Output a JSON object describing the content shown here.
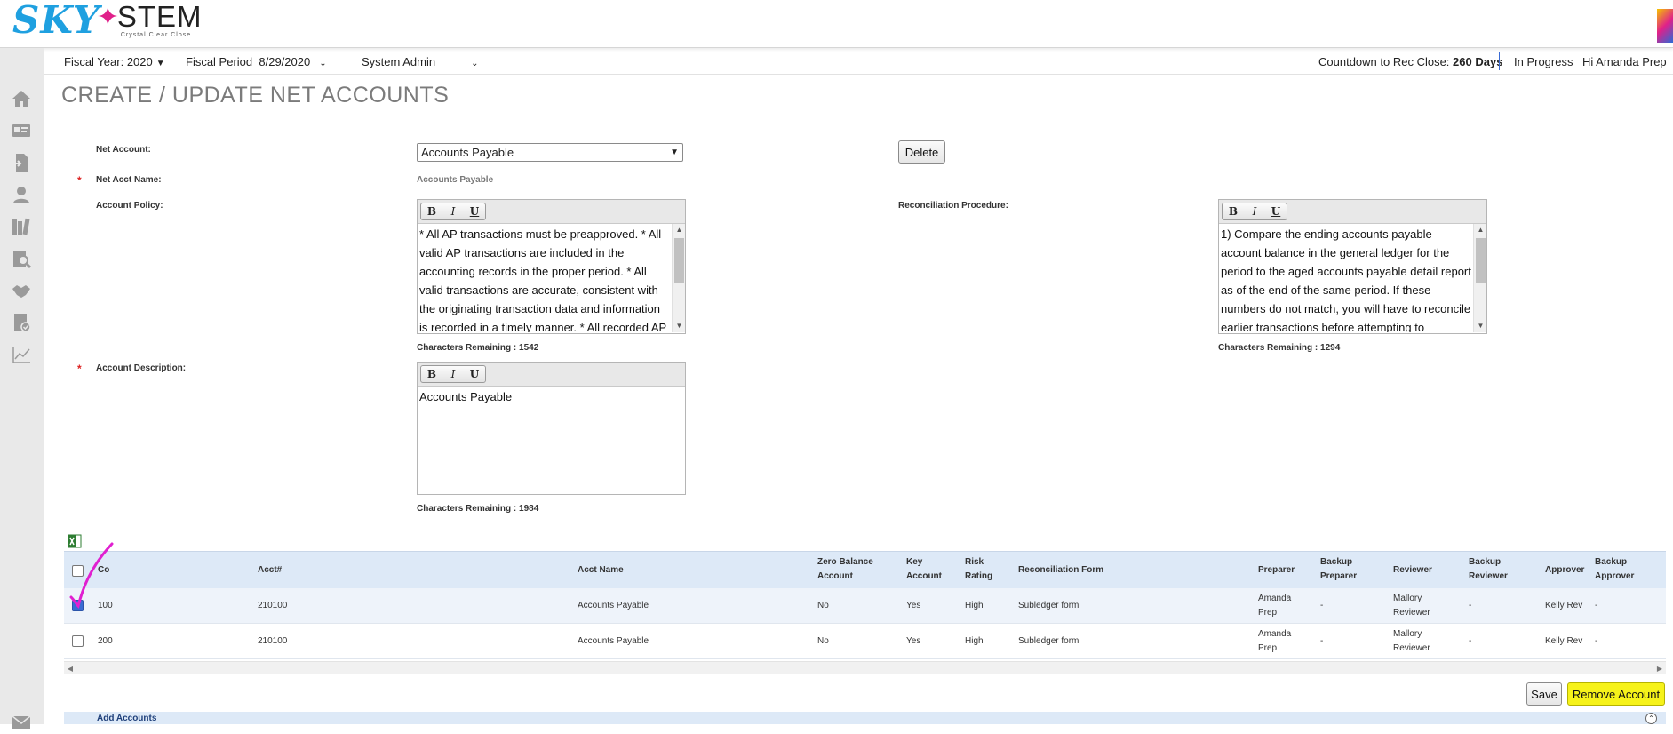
{
  "brand": {
    "logo_sky": "SKY",
    "logo_stem": "STEM",
    "tagline": "Crystal Clear Close"
  },
  "subheader": {
    "fiscal_year": "Fiscal Year: 2020",
    "fiscal_period_label": "Fiscal Period",
    "fiscal_period_value": "8/29/2020",
    "role": "System Admin",
    "countdown_label": "Countdown to Rec Close:",
    "countdown_value": "260 Days",
    "status": "In Progress",
    "greeting": "Hi Amanda Prep"
  },
  "sidebar": {
    "icons": [
      "home-icon",
      "id-card-icon",
      "document-import-icon",
      "user-icon",
      "books-icon",
      "search-report-icon",
      "handshake-icon",
      "checklist-icon",
      "chart-icon"
    ]
  },
  "page": {
    "title": "CREATE / UPDATE NET ACCOUNTS"
  },
  "form": {
    "net_account_label": "Net Account:",
    "net_account_value": "Accounts Payable",
    "delete_label": "Delete",
    "net_acct_name_label": "Net Acct Name:",
    "net_acct_name_value": "Accounts Payable",
    "account_policy_label": "Account Policy:",
    "account_policy_text": "* All AP transactions must be preapproved. * All valid AP transactions are included in the accounting records in the proper period. * All valid transactions are accurate, consistent with the originating transaction data and information is recorded in a timely manner. * All recorded AP",
    "account_policy_chars": "Characters Remaining : 1542",
    "reconciliation_procedure_label": "Reconciliation Procedure:",
    "reconciliation_procedure_text": "1) Compare the ending accounts payable account balance in the general ledger for the period to the aged accounts payable detail report as of the end of the same period.  If these numbers do not match, you will have to reconcile earlier transactions before attempting to reconcile this",
    "reconciliation_procedure_chars": "Characters Remaining : 1294",
    "account_description_label": "Account Description:",
    "account_description_text": "Accounts Payable",
    "account_description_chars": "Characters Remaining : 1984",
    "required_mark": "*"
  },
  "editor_buttons": {
    "bold": "B",
    "italic": "I",
    "underline": "U"
  },
  "table": {
    "headers": {
      "co": "Co",
      "acct_no": "Acct#",
      "acct_name": "Acct Name",
      "zero_balance_1": "Zero Balance",
      "zero_balance_2": "Account",
      "key_account_1": "Key",
      "key_account_2": "Account",
      "risk_1": "Risk",
      "risk_2": "Rating",
      "rec_form": "Reconciliation Form",
      "preparer": "Preparer",
      "backup_preparer_1": "Backup",
      "backup_preparer_2": "Preparer",
      "reviewer": "Reviewer",
      "backup_reviewer_1": "Backup",
      "backup_reviewer_2": "Reviewer",
      "approver": "Approver",
      "backup_approver_1": "Backup",
      "backup_approver_2": "Approver"
    },
    "rows": [
      {
        "checked": true,
        "co": "100",
        "acct_no": "210100",
        "acct_name": "Accounts Payable",
        "zero_balance": "No",
        "key_account": "Yes",
        "risk": "High",
        "rec_form": "Subledger form",
        "preparer_1": "Amanda",
        "preparer_2": "Prep",
        "backup_preparer": "-",
        "reviewer_1": "Mallory",
        "reviewer_2": "Reviewer",
        "backup_reviewer": "-",
        "approver": "Kelly Rev",
        "backup_approver": "-"
      },
      {
        "checked": false,
        "co": "200",
        "acct_no": "210100",
        "acct_name": "Accounts Payable",
        "zero_balance": "No",
        "key_account": "Yes",
        "risk": "High",
        "rec_form": "Subledger form",
        "preparer_1": "Amanda",
        "preparer_2": "Prep",
        "backup_preparer": "-",
        "reviewer_1": "Mallory",
        "reviewer_2": "Reviewer",
        "backup_reviewer": "-",
        "approver": "Kelly Rev",
        "backup_approver": "-"
      }
    ]
  },
  "actions": {
    "save_label": "Save",
    "remove_label": "Remove Account"
  },
  "add_accounts": {
    "label": "Add Accounts"
  },
  "colors": {
    "brand_blue": "#1fa0e0",
    "brand_pink": "#e0208a",
    "header_row": "#dde9f7",
    "highlight": "#f6f21a",
    "annotation": "#e020d0"
  }
}
